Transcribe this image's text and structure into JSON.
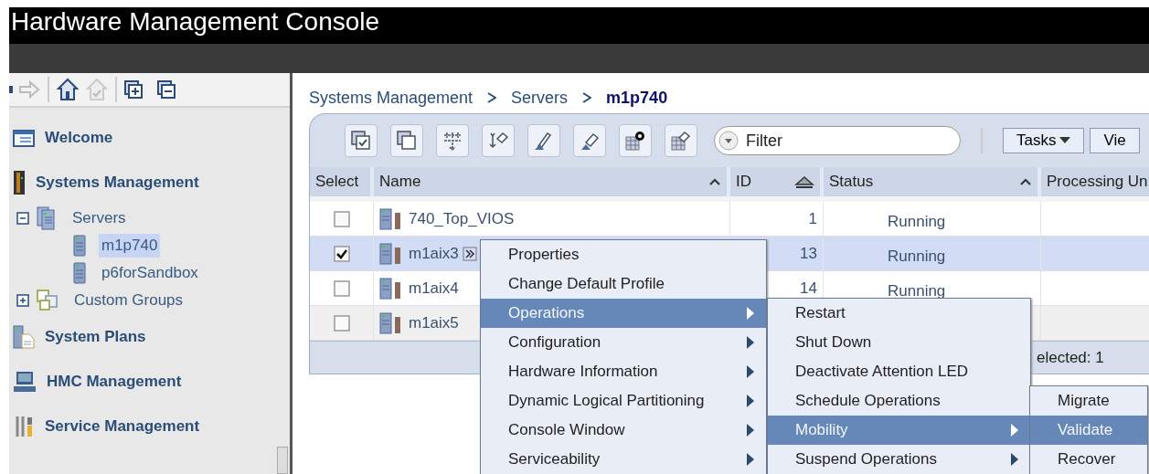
{
  "window": {
    "title": "Hardware Management Console"
  },
  "sidebar": {
    "items": [
      {
        "label": "Welcome",
        "kind": "page",
        "selected": false
      },
      {
        "label": "Systems Management",
        "kind": "systems",
        "selected": false,
        "children": [
          {
            "label": "Servers",
            "kind": "folder",
            "expanded": true,
            "selected": false,
            "children": [
              {
                "label": "m1p740",
                "kind": "server",
                "selected": true
              },
              {
                "label": "p6forSandbox",
                "kind": "server",
                "selected": false
              }
            ]
          },
          {
            "label": "Custom Groups",
            "kind": "group",
            "expanded": false,
            "selected": false
          }
        ]
      },
      {
        "label": "System Plans",
        "kind": "plans",
        "selected": false
      },
      {
        "label": "HMC Management",
        "kind": "console",
        "selected": false
      },
      {
        "label": "Service Management",
        "kind": "tools",
        "selected": false
      }
    ]
  },
  "breadcrumb": [
    "Systems Management",
    "Servers",
    "m1p740"
  ],
  "toolbar": {
    "filter": {
      "placeholder": "Filter"
    },
    "buttons": [
      "Tasks",
      "Vie"
    ]
  },
  "table": {
    "columns": [
      {
        "label": "Select",
        "sortable": false
      },
      {
        "label": "Name",
        "sortable": true,
        "sorted": false
      },
      {
        "label": "ID",
        "sortable": true,
        "sorted": true
      },
      {
        "label": "Status",
        "sortable": true,
        "sorted": false
      },
      {
        "label": "Processing Un",
        "sortable": false
      }
    ],
    "rows": [
      {
        "name": "740_Top_VIOS",
        "id": "1",
        "status": "Running",
        "checked": false,
        "selected": false,
        "menu_button": false
      },
      {
        "name": "m1aix3",
        "id": "13",
        "status": "Running",
        "checked": true,
        "selected": true,
        "menu_button": true
      },
      {
        "name": "m1aix4",
        "id": "14",
        "status": "Running",
        "checked": false,
        "selected": false,
        "menu_button": false
      },
      {
        "name": "m1aix5",
        "checked": false,
        "selected": false,
        "menu_button": false
      }
    ],
    "footer": "elected: 1"
  },
  "context_menu": {
    "items": [
      {
        "label": "Properties",
        "submenu": false,
        "selected": false
      },
      {
        "label": "Change Default Profile",
        "submenu": false,
        "selected": false
      },
      {
        "label": "Operations",
        "submenu": true,
        "selected": true
      },
      {
        "label": "Configuration",
        "submenu": true,
        "selected": false
      },
      {
        "label": "Hardware Information",
        "submenu": true,
        "selected": false
      },
      {
        "label": "Dynamic Logical Partitioning",
        "submenu": true,
        "selected": false
      },
      {
        "label": "Console Window",
        "submenu": true,
        "selected": false
      },
      {
        "label": "Serviceability",
        "submenu": true,
        "selected": false
      }
    ]
  },
  "operations_menu": {
    "items": [
      {
        "label": "Restart",
        "submenu": false,
        "selected": false
      },
      {
        "label": "Shut Down",
        "submenu": false,
        "selected": false
      },
      {
        "label": "Deactivate Attention LED",
        "submenu": false,
        "selected": false
      },
      {
        "label": "Schedule Operations",
        "submenu": false,
        "selected": false
      },
      {
        "label": "Mobility",
        "submenu": true,
        "selected": true
      },
      {
        "label": "Suspend Operations",
        "submenu": true,
        "selected": false
      }
    ]
  },
  "mobility_menu": {
    "items": [
      {
        "label": "Migrate",
        "submenu": false,
        "selected": false
      },
      {
        "label": "Validate",
        "submenu": false,
        "selected": true
      },
      {
        "label": "Recover",
        "submenu": false,
        "selected": false
      }
    ]
  }
}
